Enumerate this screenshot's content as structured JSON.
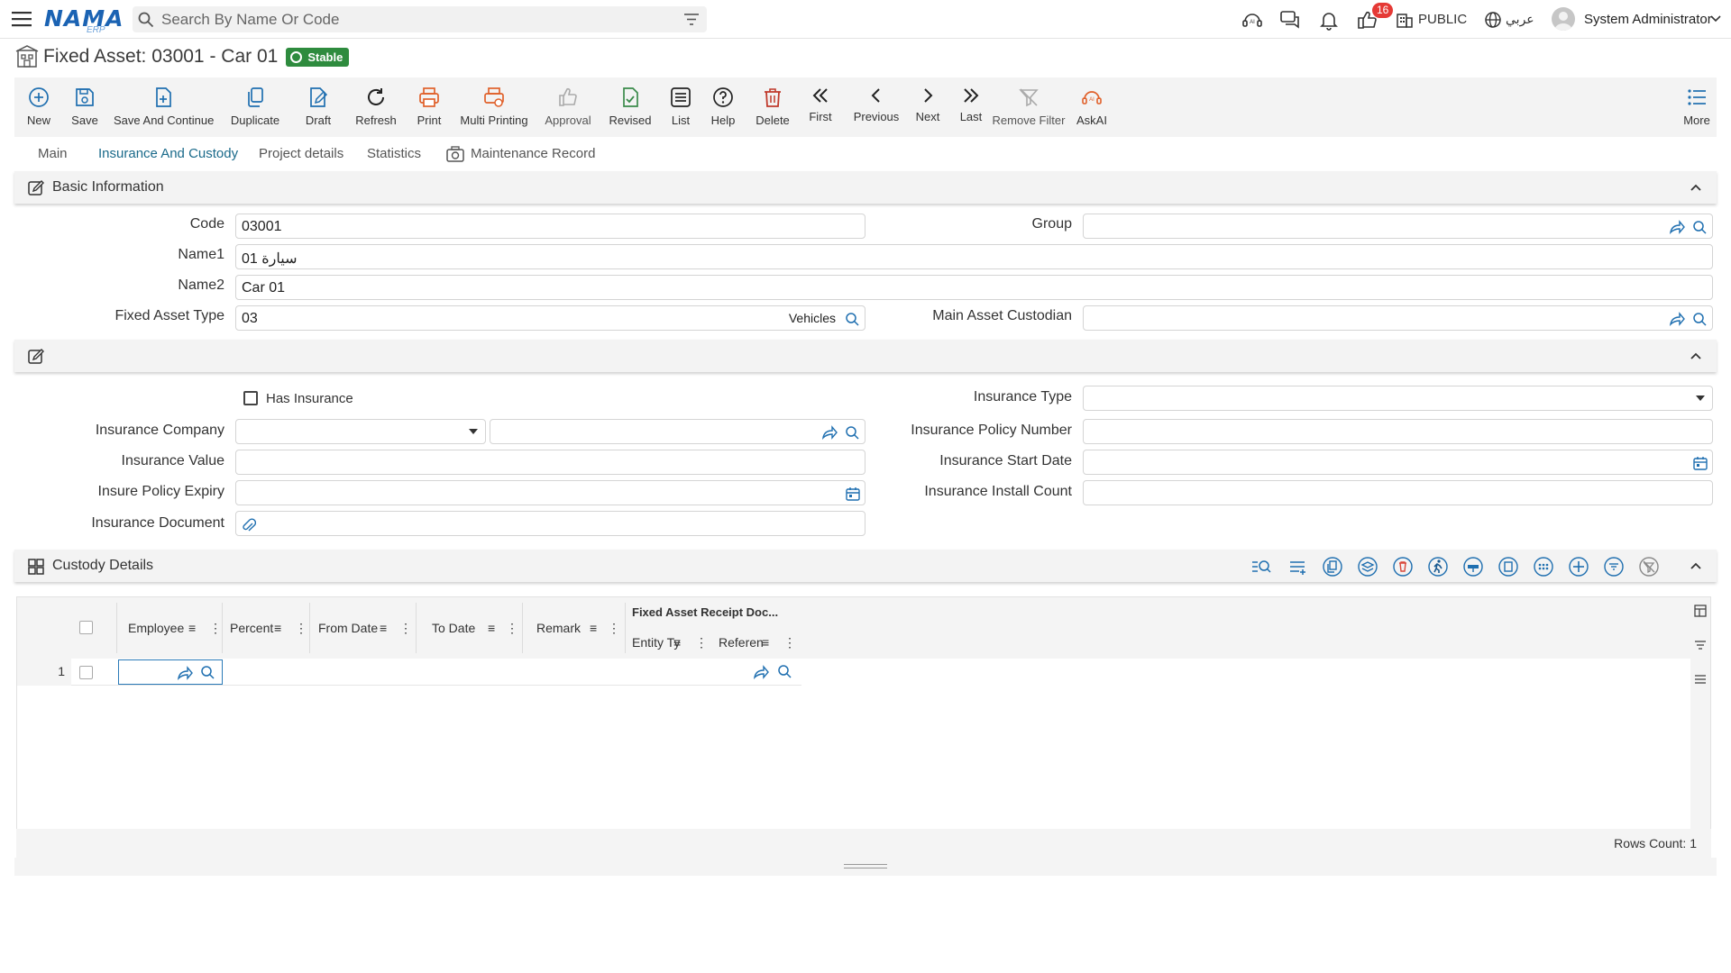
{
  "app": {
    "logo_text": "NAMA",
    "logo_sub": "ERP",
    "search_placeholder": "Search By Name Or Code",
    "notification_count": "16",
    "public_label": "PUBLIC",
    "language_label": "عربي",
    "user_name": "System Administrator"
  },
  "page": {
    "title": "Fixed Asset: 03001 - Car 01",
    "status": "Stable"
  },
  "toolbar": {
    "new": "New",
    "save": "Save",
    "save_continue": "Save And Continue",
    "duplicate": "Duplicate",
    "draft": "Draft",
    "refresh": "Refresh",
    "print": "Print",
    "multi_printing": "Multi Printing",
    "approval": "Approval",
    "revised": "Revised",
    "list": "List",
    "help": "Help",
    "delete": "Delete",
    "first": "First",
    "previous": "Previous",
    "next": "Next",
    "last": "Last",
    "remove_filter": "Remove Filter",
    "askai": "AskAI",
    "more": "More"
  },
  "tabs": {
    "main": "Main",
    "insurance": "Insurance And Custody",
    "project": "Project details",
    "statistics": "Statistics",
    "maintenance": "Maintenance Record"
  },
  "basic": {
    "title": "Basic Information",
    "code_label": "Code",
    "code_value": "03001",
    "name1_label": "Name1",
    "name1_value": "01 سيارة",
    "name2_label": "Name2",
    "name2_value": "Car 01",
    "type_label": "Fixed Asset Type",
    "type_value": "03",
    "type_name": "Vehicles",
    "group_label": "Group",
    "custodian_label": "Main Asset Custodian"
  },
  "insurance": {
    "has_insurance": "Has Insurance",
    "company_label": "Insurance Company",
    "value_label": "Insurance Value",
    "expiry_label": "Insure Policy Expiry",
    "document_label": "Insurance Document",
    "type_label": "Insurance Type",
    "policy_label": "Insurance Policy Number",
    "start_label": "Insurance Start Date",
    "install_label": "Insurance Install Count"
  },
  "custody": {
    "title": "Custody Details",
    "columns": {
      "employee": "Employee",
      "percent": "Percent",
      "from_date": "From Date",
      "to_date": "To Date",
      "remark": "Remark",
      "receipt_group": "Fixed Asset Receipt Doc...",
      "entity_type": "Entity Ty",
      "reference": "Referen"
    },
    "rows": [
      {
        "num": "1"
      }
    ],
    "rows_count": "Rows Count: 1"
  },
  "colors": {
    "accent": "#1b63b3",
    "status_green": "#2e8b3e",
    "print_orange": "#e0602a",
    "delete_red": "#c0392b",
    "revised_green": "#3a8a4a"
  }
}
